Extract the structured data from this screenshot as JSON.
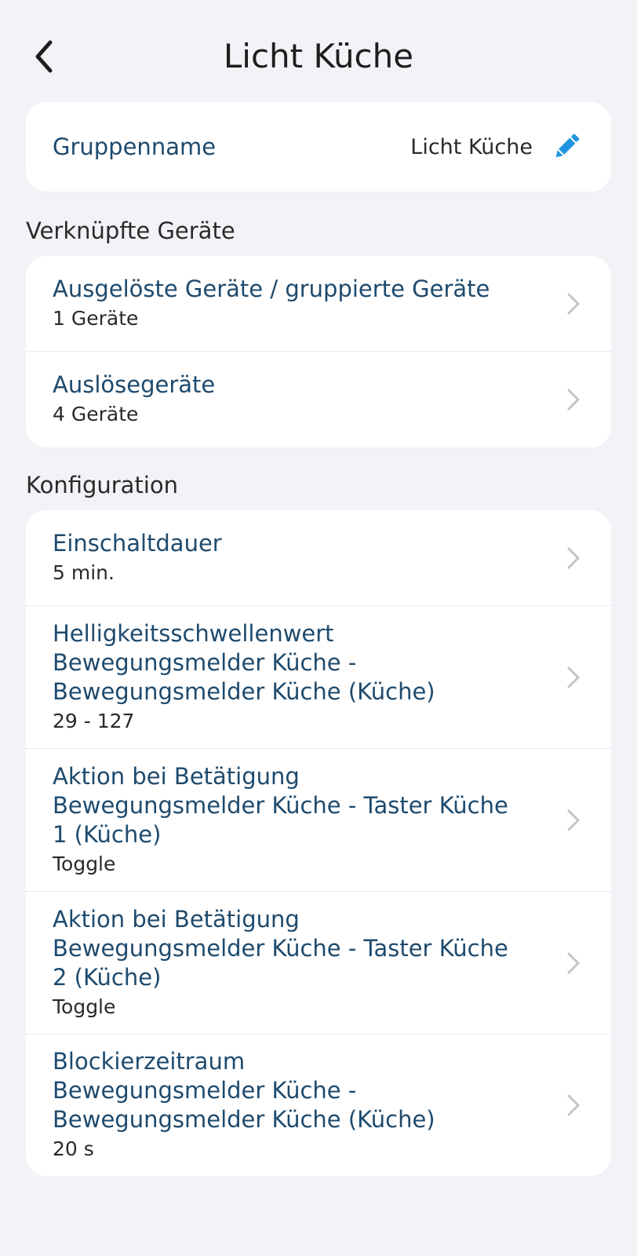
{
  "header": {
    "title": "Licht Küche",
    "back_icon": "chevron-left-icon"
  },
  "group_name": {
    "label": "Gruppenname",
    "value": "Licht Küche",
    "edit_icon": "pencil-icon",
    "edit_icon_color": "#2196e0"
  },
  "linked_devices": {
    "section_title": "Verknüpfte Geräte",
    "items": [
      {
        "title": "Ausgelöste Geräte / gruppierte Geräte",
        "subtitle": "1 Geräte"
      },
      {
        "title": "Auslösegeräte",
        "subtitle": "4 Geräte"
      }
    ]
  },
  "configuration": {
    "section_title": "Konfiguration",
    "items": [
      {
        "title": "Einschaltdauer",
        "subtitle": "5 min."
      },
      {
        "title": "Helligkeitsschwellenwert\nBewegungsmelder Küche -\nBewegungsmelder Küche (Küche)",
        "subtitle": "29 - 127"
      },
      {
        "title": "Aktion bei Betätigung\nBewegungsmelder Küche - Taster Küche\n1 (Küche)",
        "subtitle": "Toggle"
      },
      {
        "title": "Aktion bei Betätigung\nBewegungsmelder Küche - Taster Küche\n2 (Küche)",
        "subtitle": "Toggle"
      },
      {
        "title": "Blockierzeitraum\nBewegungsmelder Küche -\nBewegungsmelder Küche (Küche)",
        "subtitle": "20 s"
      }
    ]
  },
  "colors": {
    "background": "#f2f2f7",
    "accent_text": "#1e4a6d",
    "chevron": "#c4c4c8"
  }
}
